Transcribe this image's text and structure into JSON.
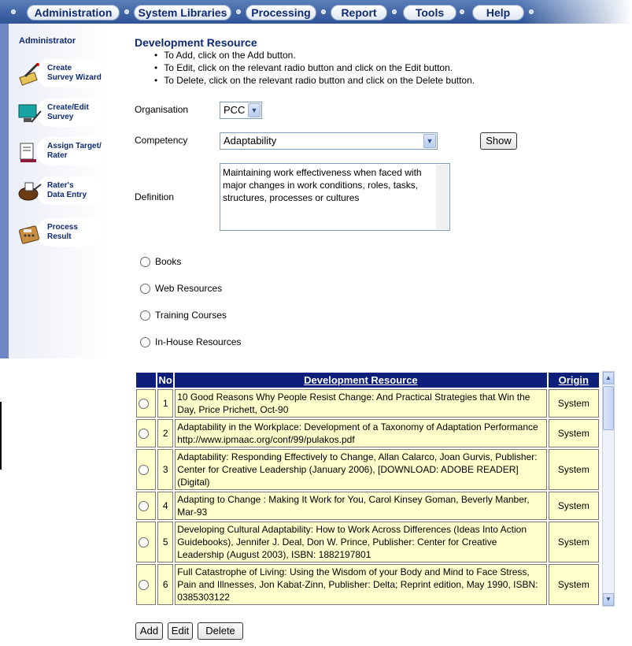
{
  "nav": {
    "items": [
      "Administration",
      "System Libraries",
      "Processing",
      "Report",
      "Tools",
      "Help"
    ]
  },
  "sidebar": {
    "title": "Administrator",
    "items": [
      {
        "line1": "Create",
        "line2": "Survey Wizard",
        "icon": "pen-wizard-icon"
      },
      {
        "line1": "Create/Edit",
        "line2": "Survey",
        "icon": "monitor-pen-icon"
      },
      {
        "line1": "Assign Target/",
        "line2": "Rater",
        "icon": "assign-target-icon"
      },
      {
        "line1": "Rater's",
        "line2": "Data Entry",
        "icon": "data-entry-icon"
      },
      {
        "line1": "Process",
        "line2": "Result",
        "icon": "calculator-icon"
      }
    ]
  },
  "page": {
    "title": "Development Resource",
    "instructions": [
      "To Add, click on the Add button.",
      "To Edit, click on the relevant radio button and click on the Edit button.",
      "To Delete, click on the relevant radio button and click on the Delete button."
    ]
  },
  "form": {
    "organisation_label": "Organisation",
    "organisation_value": "PCC",
    "competency_label": "Competency",
    "competency_value": "Adaptability",
    "show_label": "Show",
    "definition_label": "Definition",
    "definition_text": "Maintaining work effectiveness when faced with major changes in work conditions, roles, tasks, structures, processes or cultures"
  },
  "resource_types": [
    "Books",
    "Web Resources",
    "Training Courses",
    "In-House Resources"
  ],
  "table": {
    "headers": {
      "no": "No",
      "resource": "Development Resource",
      "origin": "Origin"
    },
    "rows": [
      {
        "no": "1",
        "resource": "10 Good Reasons Why People Resist Change: And Practical Strategies that Win the Day, Price Prichett, Oct-90",
        "origin": "System"
      },
      {
        "no": "2",
        "resource": "Adaptability in the Workplace: Development of a Taxonomy of Adaptation Performance http://www.ipmaac.org/conf/99/pulakos.pdf",
        "origin": "System"
      },
      {
        "no": "3",
        "resource": "Adaptability: Responding Effectively to Change, Allan Calarco, Joan Gurvis, Publisher: Center for Creative Leadership (January 2006), [DOWNLOAD: ADOBE READER] (Digital)",
        "origin": "System"
      },
      {
        "no": "4",
        "resource": "Adapting to Change : Making It Work for You, Carol Kinsey Goman, Beverly Manber, Mar-93",
        "origin": "System"
      },
      {
        "no": "5",
        "resource": "Developing Cultural Adaptability: How to Work Across Differences (Ideas Into Action Guidebooks), Jennifer J. Deal, Don W. Prince, Publisher: Center for Creative Leadership (August 2003), ISBN: 1882197801",
        "origin": "System"
      },
      {
        "no": "6",
        "resource": "Full Catastrophe of Living: Using the Wisdom of your Body and Mind to Face Stress, Pain and Illnesses, Jon Kabat-Zinn, Publisher: Delta; Reprint edition, May 1990, ISBN: 0385303122",
        "origin": "System"
      }
    ]
  },
  "actions": {
    "add": "Add",
    "edit": "Edit",
    "delete": "Delete"
  }
}
